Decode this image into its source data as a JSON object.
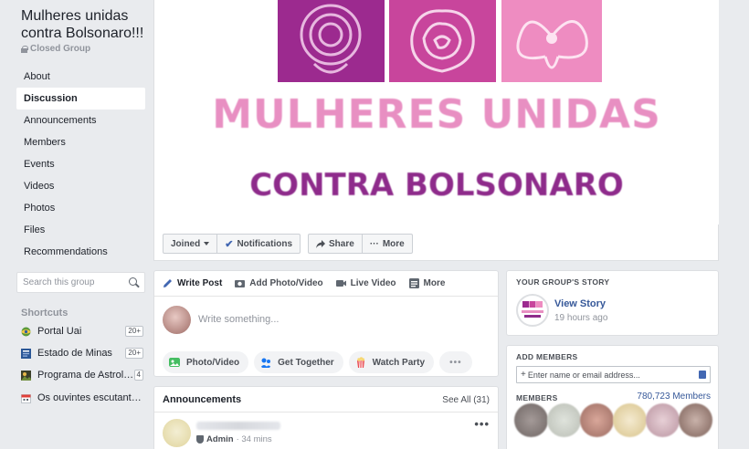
{
  "group": {
    "title": "Mulheres unidas contra Bolsonaro!!!",
    "privacy": "Closed Group"
  },
  "nav": {
    "items": [
      {
        "label": "About",
        "active": false
      },
      {
        "label": "Discussion",
        "active": true
      },
      {
        "label": "Announcements",
        "active": false
      },
      {
        "label": "Members",
        "active": false
      },
      {
        "label": "Events",
        "active": false
      },
      {
        "label": "Videos",
        "active": false
      },
      {
        "label": "Photos",
        "active": false
      },
      {
        "label": "Files",
        "active": false
      },
      {
        "label": "Recommendations",
        "active": false
      }
    ]
  },
  "search": {
    "placeholder": "Search this group"
  },
  "shortcuts": {
    "heading": "Shortcuts",
    "items": [
      {
        "label": "Portal Uai",
        "badge": "20+",
        "icon": "globe-icon"
      },
      {
        "label": "Estado de Minas",
        "badge": "20+",
        "icon": "news-icon"
      },
      {
        "label": "Programa de Astrolo...",
        "badge": "4",
        "icon": "photo-icon"
      },
      {
        "label": "Os ouvintes escutantes ...",
        "badge": "",
        "icon": "calendar-icon"
      }
    ]
  },
  "cover": {
    "line1": "MULHERES UNIDAS",
    "line2": "CONTRA BOLSONARO"
  },
  "actions": {
    "joined": "Joined",
    "notifications": "Notifications",
    "share": "Share",
    "more": "More"
  },
  "composer": {
    "tabs": [
      "Write Post",
      "Add Photo/Video",
      "Live Video",
      "More"
    ],
    "placeholder": "Write something...",
    "pills": [
      "Photo/Video",
      "Get Together",
      "Watch Party"
    ],
    "more_dots": "•••"
  },
  "announcements": {
    "heading": "Announcements",
    "see_all": "See All (31)",
    "post_role": "Admin",
    "post_time": "· 34 mins",
    "menu_dots": "•••"
  },
  "story": {
    "heading": "YOUR GROUP'S STORY",
    "title": "View Story",
    "time": "19 hours ago"
  },
  "add_members": {
    "heading": "ADD MEMBERS",
    "placeholder": "Enter name or email address...",
    "members_heading": "MEMBERS",
    "members_count": "780,723 Members"
  },
  "colors": {
    "link": "#365899",
    "accent": "#4267b2",
    "cover_pink": "#e88fc2",
    "cover_purple": "#8e2b8b"
  }
}
